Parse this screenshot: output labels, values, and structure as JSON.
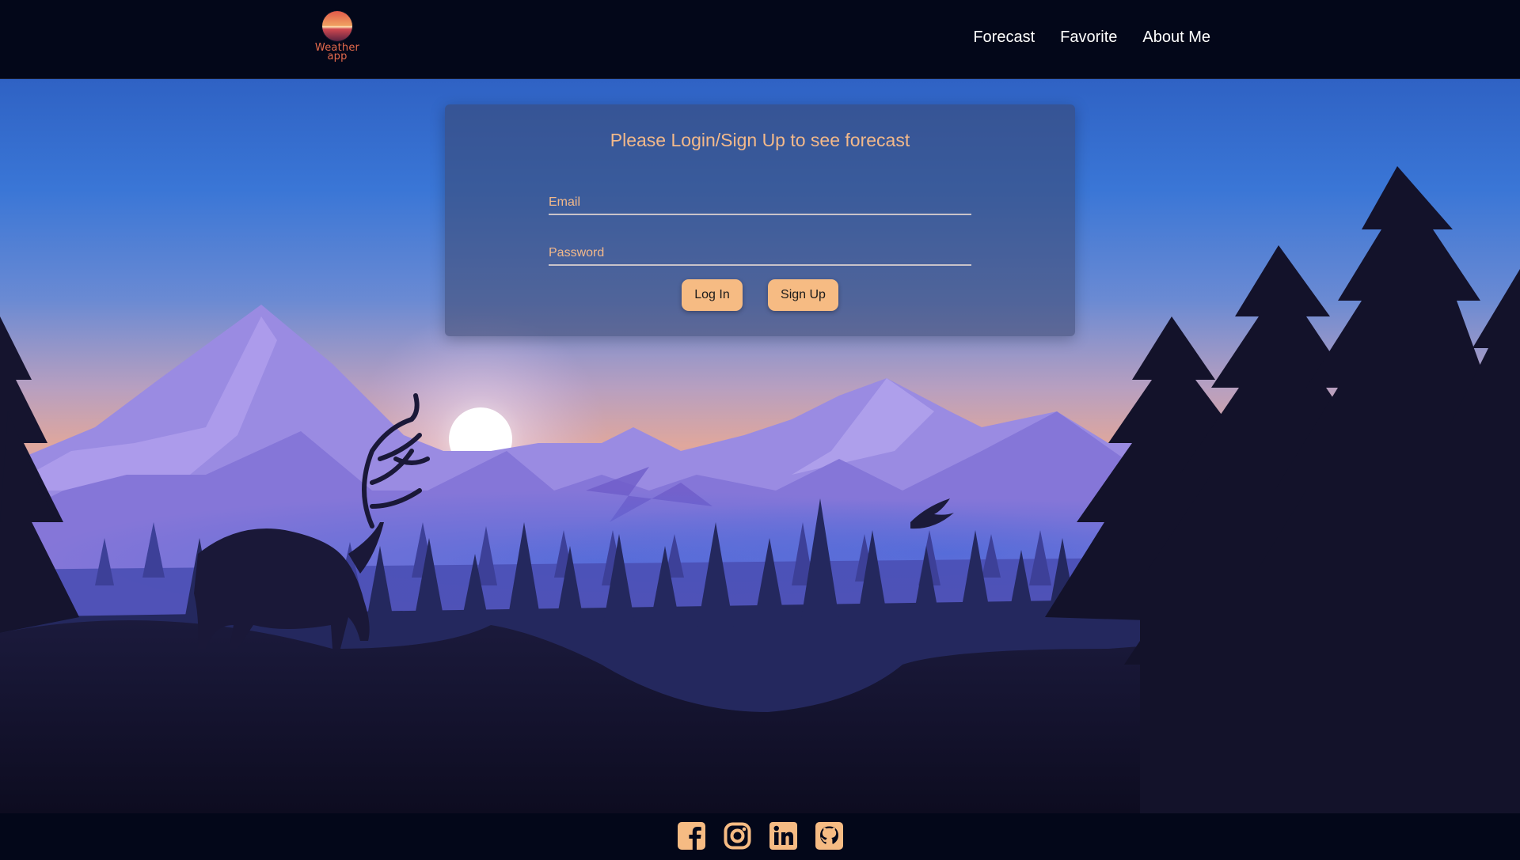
{
  "header": {
    "logo_text": "Weather app",
    "nav": [
      {
        "label": "Forecast"
      },
      {
        "label": "Favorite"
      },
      {
        "label": "About Me"
      }
    ]
  },
  "login": {
    "title": "Please Login/Sign Up to see forecast",
    "email_placeholder": "Email",
    "password_placeholder": "Password",
    "login_label": "Log In",
    "signup_label": "Sign Up"
  },
  "footer": {
    "socials": [
      {
        "icon": "facebook-icon"
      },
      {
        "icon": "instagram-icon"
      },
      {
        "icon": "linkedin-icon"
      },
      {
        "icon": "github-icon"
      }
    ]
  },
  "colors": {
    "navbar_bg": "#030719",
    "accent": "#f6bb83",
    "accent_text": "#f3b98a",
    "card_bg": "rgba(58,70,108,0.55)"
  }
}
